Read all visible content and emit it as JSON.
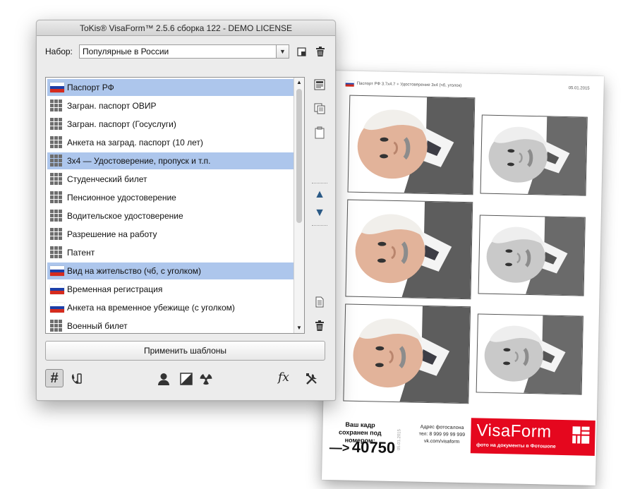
{
  "app": {
    "title": "ToKis® VisaForm™ 2.5.6 сборка 122 - DEMO LICENSE"
  },
  "set_selector": {
    "label": "Набор:",
    "value": "Популярные в России"
  },
  "templates": [
    {
      "label": "Паспорт РФ",
      "icon": "russian-flag-icon",
      "selected": true
    },
    {
      "label": "Загран. паспорт ОВИР",
      "icon": "grid-icon",
      "selected": false
    },
    {
      "label": "Загран. паспорт (Госуслуги)",
      "icon": "grid-icon",
      "selected": false
    },
    {
      "label": "Анкета на заград. паспорт (10 лет)",
      "icon": "grid-icon",
      "selected": false
    },
    {
      "label": "3x4 — Удостоверение, пропуск и т.п.",
      "icon": "grid-icon",
      "selected": true
    },
    {
      "label": "Студенческий билет",
      "icon": "grid-icon",
      "selected": false
    },
    {
      "label": "Пенсионное удостоверение",
      "icon": "grid-icon",
      "selected": false
    },
    {
      "label": "Водительское удостоверение",
      "icon": "grid-icon",
      "selected": false
    },
    {
      "label": "Разрешение на работу",
      "icon": "grid-icon",
      "selected": false
    },
    {
      "label": "Патент",
      "icon": "grid-icon",
      "selected": false
    },
    {
      "label": "Вид на жительство (чб, с уголком)",
      "icon": "russian-flag-icon",
      "selected": true
    },
    {
      "label": "Временная регистрация",
      "icon": "russian-flag-icon",
      "selected": false
    },
    {
      "label": "Анкета на временное убежище (с уголком)",
      "icon": "russian-flag-icon",
      "selected": false
    },
    {
      "label": "Военный билет",
      "icon": "grid-icon",
      "selected": false
    }
  ],
  "apply_button": "Применить шаблоны",
  "toolbar_icons": [
    "grid-toggle-icon",
    "phone-icon",
    "person-icon",
    "contrast-icon",
    "radiation-icon",
    "fx-icon",
    "tools-icon"
  ],
  "fx_label": "fx",
  "preview": {
    "header_title": "Паспорт РФ 3.7x4.7 + Удостоверение 3x4 (чб, уголок)",
    "header_date": "05.01.2015",
    "saved_text": "Ваш кадр сохранен под номером:",
    "arrow": "—>",
    "frame_number": "40750",
    "vertical_date": "05.01.2015",
    "studio_lines": [
      "Адрес фотосалона",
      "тел: 8 999 99 99 999",
      "vk.com/visaform"
    ],
    "logo_word": "VisaForm",
    "logo_tagline": "фото на документы в Фотошопе"
  },
  "colors": {
    "selection": "#adc6ec",
    "logo_red": "#e5071e",
    "flag_white": "#ffffff",
    "flag_blue": "#1c3fa8",
    "flag_red": "#d52b1e"
  }
}
